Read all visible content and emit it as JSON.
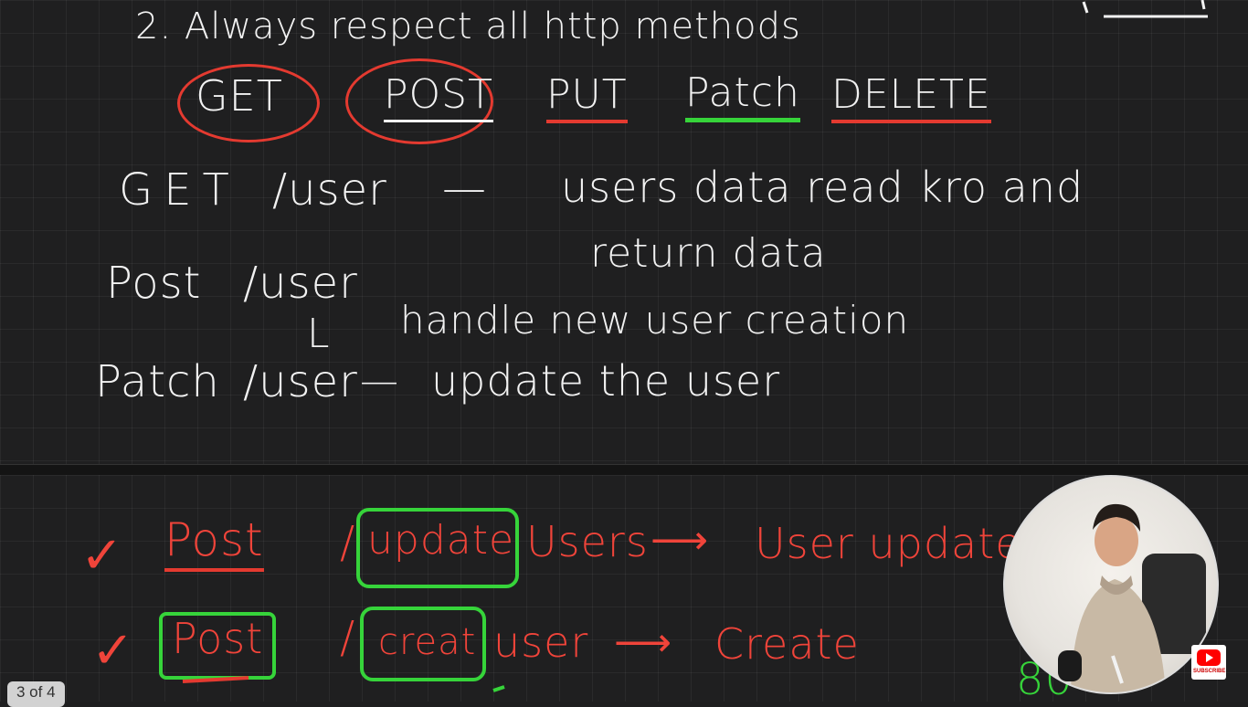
{
  "slide": {
    "heading": "2. Always respect all http methods",
    "methods": [
      "GET",
      "POST",
      "PUT",
      "Patch",
      "DELETE"
    ],
    "lines": [
      {
        "method": "GET",
        "path": "/user",
        "dash": "—",
        "desc": "users data read kro and"
      },
      {
        "continuation": "return data"
      },
      {
        "method": "Post",
        "path": "/user",
        "branch": "L",
        "desc": "handle new user creation"
      },
      {
        "method": "Patch",
        "path": "/user",
        "dash": "—",
        "desc": "update the user"
      }
    ]
  },
  "bottom": {
    "rows": [
      {
        "check": "✓",
        "method": "Post",
        "path_slash": "/",
        "action": "update",
        "resource": "Users",
        "arrow": "⟶",
        "result": "User update"
      },
      {
        "check": "✓",
        "method": "Post",
        "path_slash": "/",
        "action": "creat",
        "resource": "user",
        "arrow": "⟶",
        "result": "Create"
      }
    ],
    "green_note": "80"
  },
  "page_indicator": "3 of 4",
  "youtube_badge": {
    "label": "SUBSCRIBE",
    "icon": "youtube-icon"
  },
  "colors": {
    "board": "#1f1f20",
    "ink_white": "#f2f2f2",
    "ink_red": "#f0443a",
    "ink_green": "#36d43a"
  }
}
